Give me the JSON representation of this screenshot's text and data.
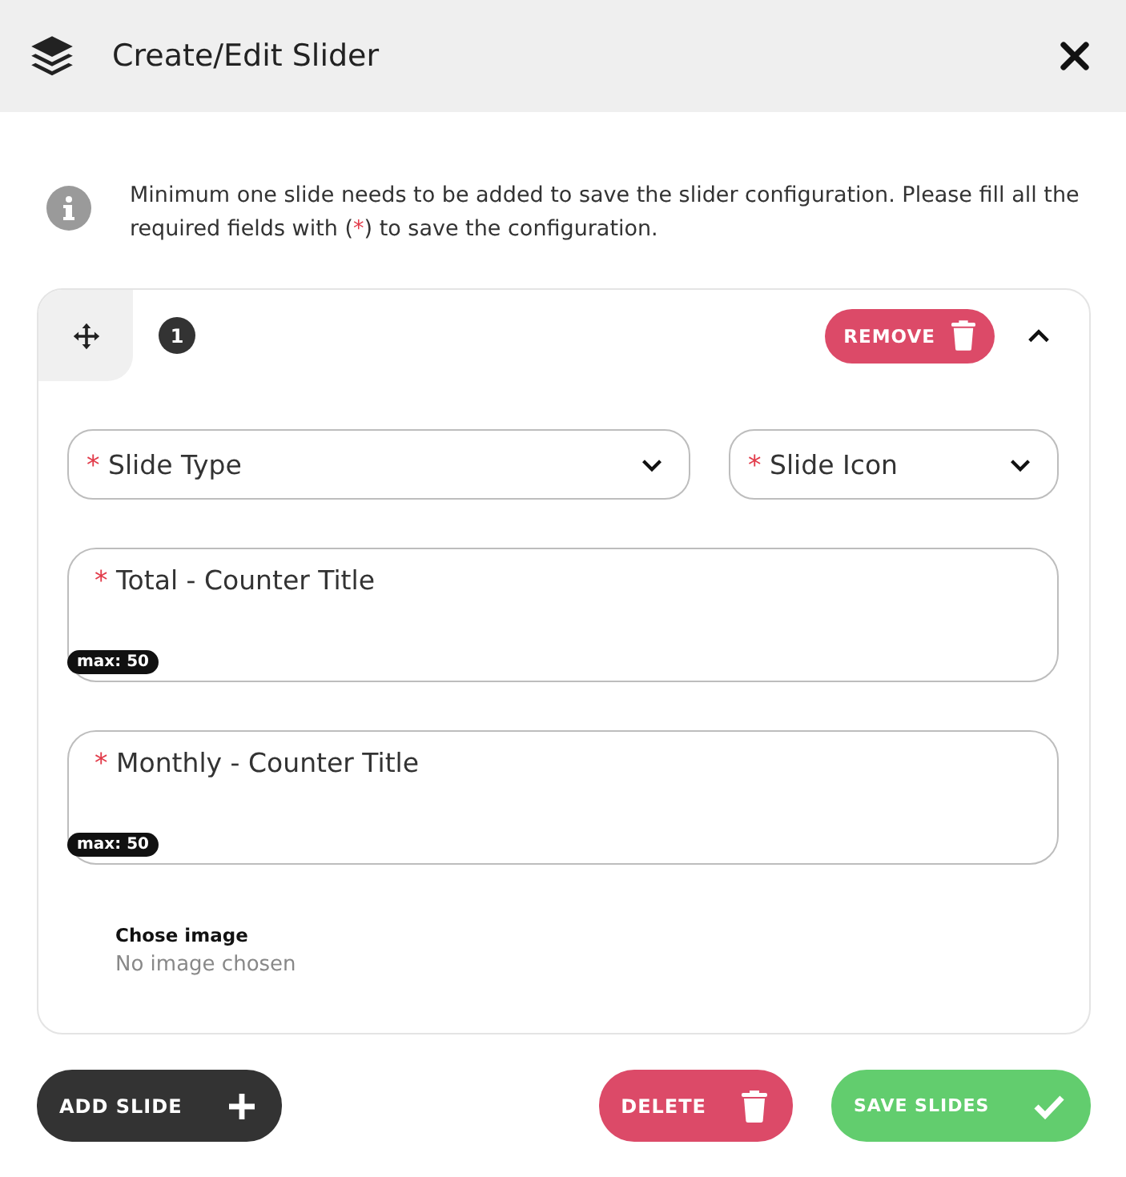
{
  "window": {
    "title": "Create/Edit Slider"
  },
  "notice": {
    "before": "Minimum one slide needs to be added to save the slider configuration. Please fill all the required fields with (",
    "mark": "*",
    "after": ") to save the configuration."
  },
  "slides": [
    {
      "number": "1",
      "expanded": true,
      "remove_label": "REMOVE",
      "selects": [
        {
          "mark": "*",
          "placeholder": "Slide Type"
        },
        {
          "mark": "*",
          "placeholder": "Slide Icon"
        }
      ],
      "text_fields": [
        {
          "mark": "*",
          "placeholder": "Total - Counter Title",
          "counter": "max: 50"
        },
        {
          "mark": "*",
          "placeholder": "Monthly - Counter Title",
          "counter": "max: 50"
        }
      ],
      "image": {
        "label": "Chose image",
        "value": "No image chosen"
      }
    }
  ],
  "buttons": [
    {
      "kind": "add",
      "label": "ADD SLIDE"
    },
    {
      "kind": "delete",
      "label": "DELETE"
    },
    {
      "kind": "save",
      "label": "SAVE SLIDES"
    }
  ]
}
